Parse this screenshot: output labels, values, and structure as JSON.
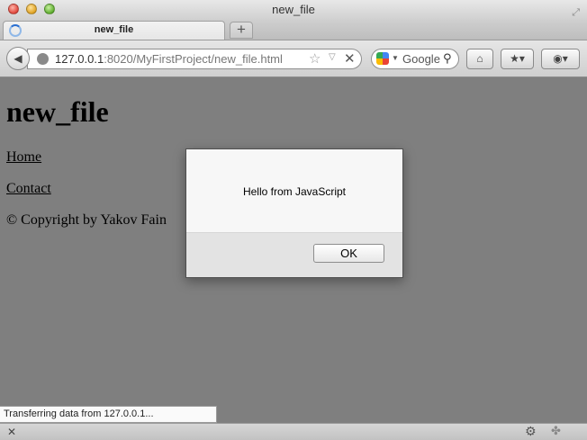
{
  "window": {
    "title": "new_file"
  },
  "tabs": [
    {
      "label": "new_file",
      "loading": true
    }
  ],
  "toolbar": {
    "url_host": "127.0.0.1",
    "url_rest": ":8020/MyFirstProject/new_file.html",
    "search_engine": "Google"
  },
  "page": {
    "heading": "new_file",
    "links": [
      "Home",
      "Contact"
    ],
    "copyright": "© Copyright by Yakov Fain"
  },
  "dialog": {
    "message": "Hello from JavaScript",
    "ok_label": "OK"
  },
  "status": {
    "text": "Transferring data from 127.0.0.1..."
  },
  "icons": {
    "close": "close-icon",
    "gear": "gear-icon",
    "home": "home-icon"
  }
}
